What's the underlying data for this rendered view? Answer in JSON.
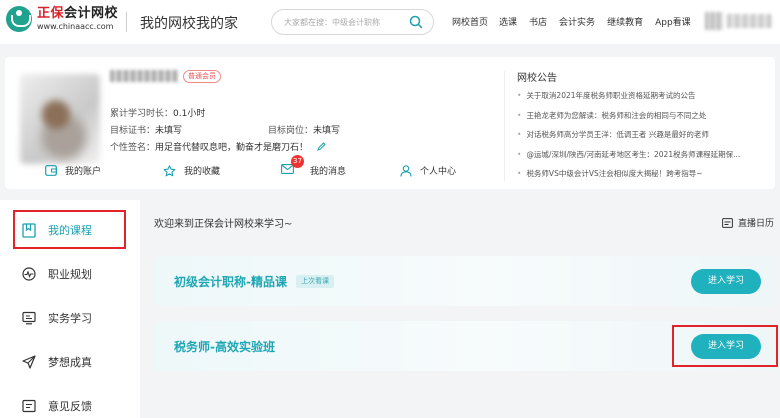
{
  "header": {
    "logo_brand": "正保",
    "logo_name": "会计网校",
    "logo_url": "www.chinaacc.com",
    "slogan": "我的网校我的家",
    "search_placeholder": "大家都在搜：中级会计职称",
    "nav": [
      "网校首页",
      "选课",
      "书店",
      "会计实务",
      "继续教育",
      "App看课"
    ]
  },
  "profile": {
    "member_badge": "普通会员",
    "study_time_label": "累计学习时长：",
    "study_time_value": "0.1小时",
    "target_cert_label": "目标证书：",
    "target_cert_value": "未填写",
    "target_post_label": "目标岗位：",
    "target_post_value": "未填写",
    "signature_label": "个性签名：",
    "signature_value": "用足音代替叹息吧，勤奋才是磨刀石！",
    "quick_links": [
      {
        "label": "我的账户",
        "icon": "wallet-icon"
      },
      {
        "label": "我的收藏",
        "icon": "star-icon"
      },
      {
        "label": "我的消息",
        "icon": "mail-icon",
        "badge": "37"
      },
      {
        "label": "个人中心",
        "icon": "person-icon"
      }
    ]
  },
  "notices": {
    "title": "网校公告",
    "items": [
      "关于取消2021年度税务师职业资格延期考试的公告",
      "王艳龙老师为您解读：税务师和注会的相同与不同之处",
      "对话税务师高分学员王洋：低调王者 兴趣是最好的老师",
      "@运城/深圳/陕西/河南延考地区考生：2021税务师课程延期保...",
      "税务师VS中级会计VS注会相似度大揭秘！跨考指导~"
    ]
  },
  "sidebar": {
    "items": [
      {
        "label": "我的课程",
        "icon": "bookmark-icon"
      },
      {
        "label": "职业规划",
        "icon": "pulse-icon"
      },
      {
        "label": "实务学习",
        "icon": "monitor-icon"
      },
      {
        "label": "梦想成真",
        "icon": "send-icon"
      },
      {
        "label": "意见反馈",
        "icon": "feedback-icon"
      }
    ]
  },
  "main": {
    "welcome": "欢迎来到正保会计网校来学习~",
    "calendar_label": "直播日历",
    "courses": [
      {
        "name": "初级会计职称-精品课",
        "tag": "上次看课",
        "button": "进入学习"
      },
      {
        "name": "税务师-高效实验班",
        "tag": "",
        "button": "进入学习"
      }
    ]
  },
  "colors": {
    "accent": "#1fb1bd",
    "highlight_outline": "#e0242a",
    "badge_red": "#e33333"
  }
}
